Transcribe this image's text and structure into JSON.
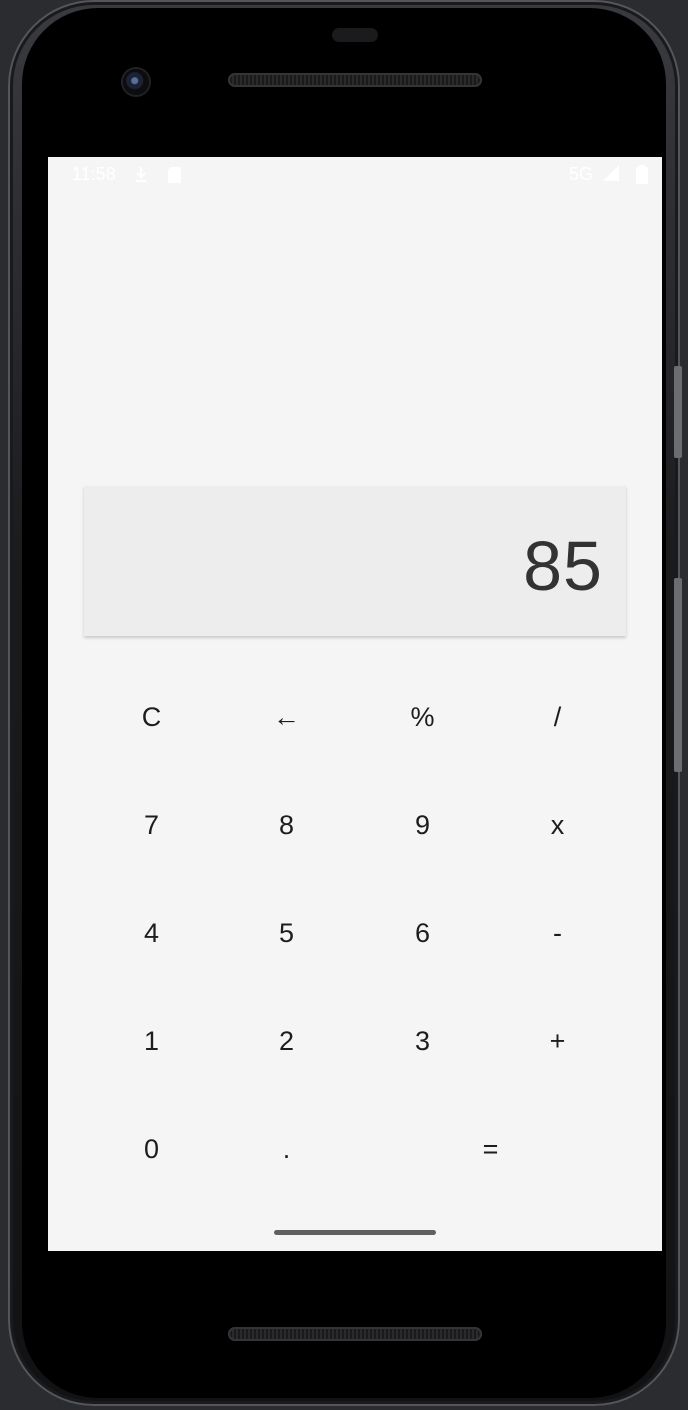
{
  "status_bar": {
    "time": "11:58",
    "network": "5G",
    "icons": [
      "download-icon",
      "sim-card-icon",
      "signal-icon",
      "battery-icon"
    ]
  },
  "calculator": {
    "display_value": "85",
    "keys": [
      {
        "label": "C",
        "name": "clear-button"
      },
      {
        "label": "←",
        "name": "backspace-button"
      },
      {
        "label": "%",
        "name": "percent-button"
      },
      {
        "label": "/",
        "name": "divide-button"
      },
      {
        "label": "7",
        "name": "digit-7-button"
      },
      {
        "label": "8",
        "name": "digit-8-button"
      },
      {
        "label": "9",
        "name": "digit-9-button"
      },
      {
        "label": "x",
        "name": "multiply-button"
      },
      {
        "label": "4",
        "name": "digit-4-button"
      },
      {
        "label": "5",
        "name": "digit-5-button"
      },
      {
        "label": "6",
        "name": "digit-6-button"
      },
      {
        "label": "-",
        "name": "subtract-button"
      },
      {
        "label": "1",
        "name": "digit-1-button"
      },
      {
        "label": "2",
        "name": "digit-2-button"
      },
      {
        "label": "3",
        "name": "digit-3-button"
      },
      {
        "label": "+",
        "name": "add-button"
      },
      {
        "label": "0",
        "name": "digit-0-button"
      },
      {
        "label": ".",
        "name": "decimal-button"
      },
      {
        "label": "=",
        "name": "equals-button"
      }
    ]
  },
  "colors": {
    "screen_background": "#f5f5f5",
    "display_background": "#ededed",
    "display_text": "#333333",
    "key_text": "#1d1d1d",
    "home_indicator": "#606060"
  }
}
